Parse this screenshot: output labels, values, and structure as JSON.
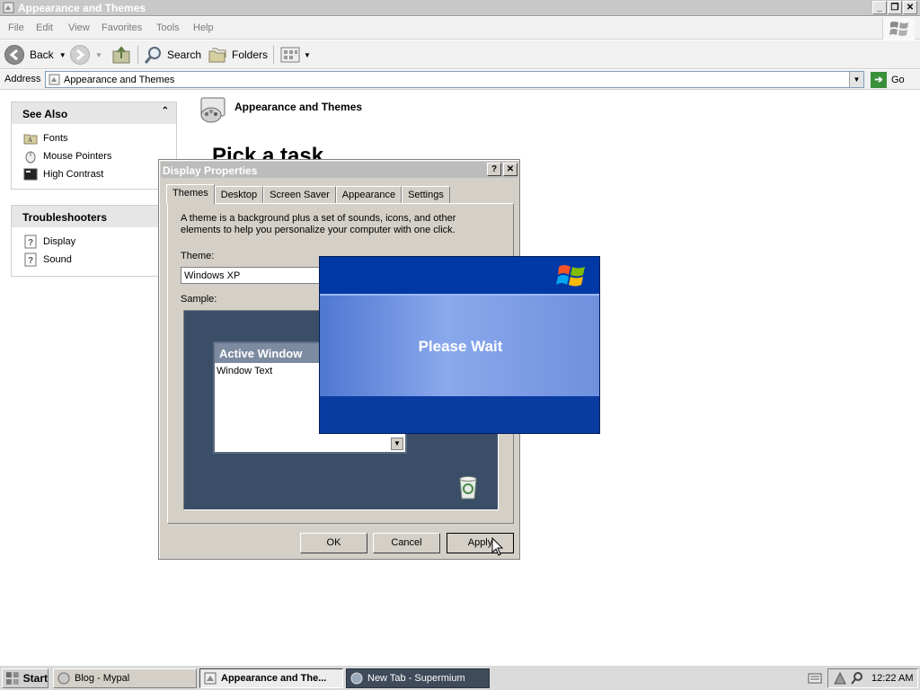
{
  "window": {
    "title": "Appearance and Themes",
    "minimize_glyph": "_",
    "maximize_glyph": "❐",
    "close_glyph": "✕"
  },
  "menu": [
    "File",
    "Edit",
    "View",
    "Favorites",
    "Tools",
    "Help"
  ],
  "toolbar": {
    "back_label": "Back",
    "search_label": "Search",
    "folders_label": "Folders"
  },
  "address": {
    "label": "Address",
    "value": "Appearance and Themes",
    "go_label": "Go"
  },
  "see_also": {
    "title": "See Also",
    "items": [
      "Fonts",
      "Mouse Pointers",
      "High Contrast"
    ]
  },
  "troubleshooters": {
    "title": "Troubleshooters",
    "items": [
      "Display",
      "Sound"
    ]
  },
  "main": {
    "header": "Appearance and Themes",
    "pick_task": "Pick a task"
  },
  "dialog": {
    "title": "Display Properties",
    "help_glyph": "?",
    "close_glyph": "✕",
    "tabs": [
      "Themes",
      "Desktop",
      "Screen Saver",
      "Appearance",
      "Settings"
    ],
    "description": "A theme is a background plus a set of sounds, icons, and other elements to help you personalize your computer with one click.",
    "theme_label": "Theme:",
    "theme_value": "Windows XP",
    "sample_label": "Sample:",
    "active_window_title": "Active Window",
    "window_text": "Window Text",
    "ok_label": "OK",
    "cancel_label": "Cancel",
    "apply_label": "Apply"
  },
  "splash": {
    "message": "Please Wait"
  },
  "taskbar": {
    "start_label": "Start",
    "tasks": [
      "Blog - Mypal",
      "Appearance and The...",
      "New Tab - Supermium"
    ],
    "clock": "12:22 AM"
  },
  "colors": {
    "splash_blue": "#0039a6",
    "splash_band": "#8aa8ec",
    "dialog_face": "#d4d0c8"
  }
}
